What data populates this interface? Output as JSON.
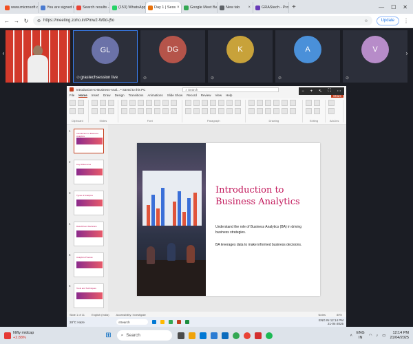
{
  "browser": {
    "tabs": [
      {
        "label": "www.microsoft.c",
        "color": "#f25022"
      },
      {
        "label": "You are signed in",
        "color": "#4a7bd0"
      },
      {
        "label": "Search results - s",
        "color": "#ea4335"
      },
      {
        "label": "(153) WhatsApp",
        "color": "#25d366"
      },
      {
        "label": "Day 1 | Sess",
        "color": "#e8710a",
        "active": true
      },
      {
        "label": "Google Meet Bac",
        "color": "#34a853"
      },
      {
        "label": "New tab",
        "color": "#5f6368"
      },
      {
        "label": "GRAStech - Proje",
        "color": "#673ab7"
      }
    ],
    "url": "https://meeting.zoho.in/Pmw2-W9d-j5o",
    "update_label": "Update"
  },
  "meeting": {
    "participants": [
      {
        "initials": "GL",
        "name": "grastechsession live",
        "color": "#6b72a8"
      },
      {
        "initials": "DG",
        "name": "",
        "color": "#b5544a"
      },
      {
        "initials": "K",
        "name": "",
        "color": "#c8a23a"
      },
      {
        "initials": "A",
        "name": "",
        "color": "#4a90d9"
      },
      {
        "initials": "V",
        "name": "",
        "color": "#b78cc9"
      }
    ]
  },
  "powerpoint": {
    "filename": "Introduction-to-Business-Anal... • Saved to this PC",
    "search_placeholder": "Search",
    "menu": [
      "File",
      "Home",
      "Insert",
      "Draw",
      "Design",
      "Transitions",
      "Animations",
      "Slide Show",
      "Record",
      "Review",
      "View",
      "Help"
    ],
    "share_label": "Share",
    "ribbon_groups": [
      "Clipboard",
      "Slides",
      "Font",
      "Paragraph",
      "Drawing",
      "Editing",
      "Add-ins"
    ],
    "thumbs": [
      {
        "num": "1",
        "title": "Introduction to Business Analytics"
      },
      {
        "num": "2",
        "title": "Key Differences"
      },
      {
        "num": "3",
        "title": "Types of Analytics"
      },
      {
        "num": "4",
        "title": "Data Driven Decisions"
      },
      {
        "num": "5",
        "title": "Analytics Process"
      },
      {
        "num": "6",
        "title": "Tools and Techniques"
      }
    ],
    "slide": {
      "title": "Introduction to Business Analytics",
      "body1": "Understand the role of Business Analytics (BA) in driving business strategies.",
      "body2": "BA leverages data to make informed business decisions."
    },
    "status_left": "Slide 1 of 11",
    "status_lang": "English (India)",
    "status_access": "Accessibility: Investigate",
    "status_notes": "Notes",
    "status_zoom": "80%"
  },
  "inner_taskbar": {
    "temp": "28°C",
    "weather": "Haze",
    "search": "Search",
    "lang": "ENG IN",
    "time": "12:14 PM",
    "date": "21-04-2025"
  },
  "taskbar": {
    "ticker": "Nifty midcap",
    "change": "+2.88%",
    "search": "Search",
    "lang_top": "ENG",
    "lang_bottom": "IN",
    "time": "12:14 PM",
    "date": "21/04/2025"
  }
}
